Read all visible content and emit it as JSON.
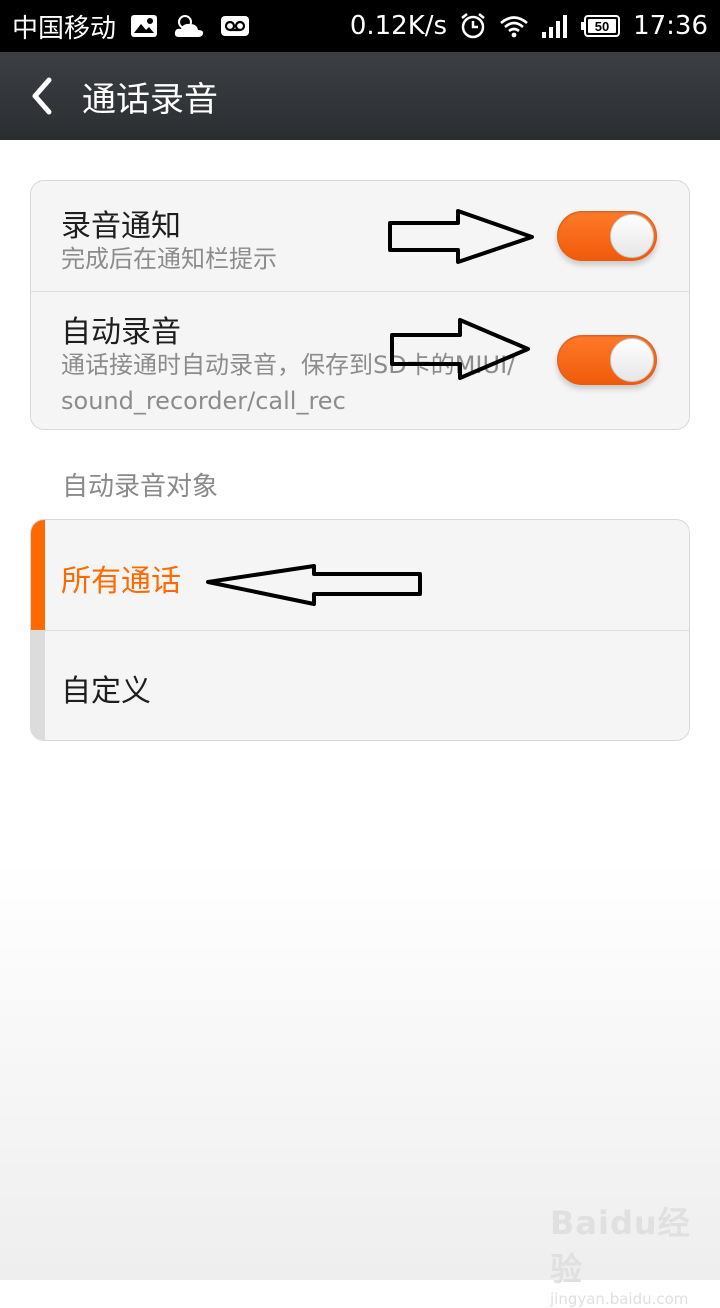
{
  "status_bar": {
    "carrier": "中国移动",
    "net_speed": "0.12K/s",
    "battery": "50",
    "time": "17:36",
    "icons": [
      "gallery-icon",
      "cloudy-weather-icon",
      "voicemail-icon",
      "alarm-icon",
      "wifi-icon",
      "signal-icon",
      "battery-icon"
    ]
  },
  "header": {
    "title": "通话录音"
  },
  "settings": {
    "items": [
      {
        "title": "录音通知",
        "subtitle": "完成后在通知栏提示",
        "enabled": true
      },
      {
        "title": "自动录音",
        "subtitle": "通话接通时自动录音，保存到SD卡的MIUI/sound_recorder/call_rec",
        "enabled": true
      }
    ]
  },
  "section": {
    "label": "自动录音对象"
  },
  "target_options": {
    "selected": 0,
    "items": [
      {
        "label": "所有通话"
      },
      {
        "label": "自定义"
      }
    ]
  },
  "colors": {
    "accent": "#ff6a00",
    "title_bar": "#2f3235",
    "card_bg": "#f5f5f5"
  },
  "watermark": {
    "logo": "Baidu经验",
    "url": "jingyan.baidu.com"
  }
}
